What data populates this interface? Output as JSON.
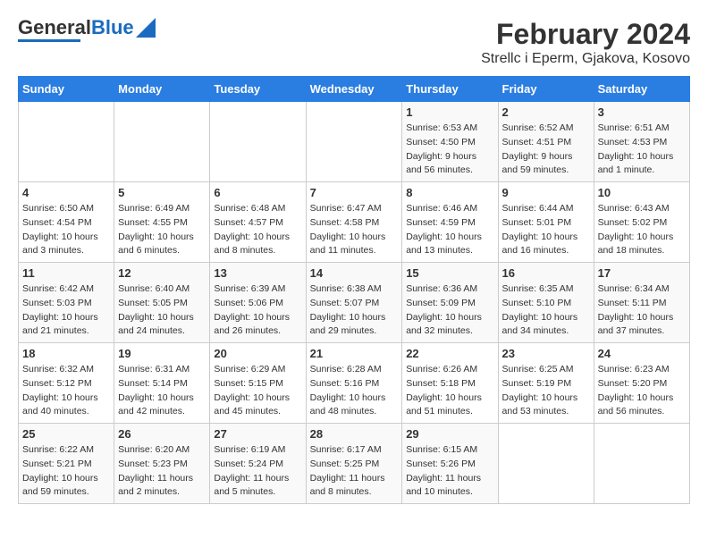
{
  "header": {
    "logo_general": "General",
    "logo_blue": "Blue",
    "title": "February 2024",
    "subtitle": "Strellc i Eperm, Gjakova, Kosovo"
  },
  "calendar": {
    "days_of_week": [
      "Sunday",
      "Monday",
      "Tuesday",
      "Wednesday",
      "Thursday",
      "Friday",
      "Saturday"
    ],
    "weeks": [
      [
        {
          "day": "",
          "info": ""
        },
        {
          "day": "",
          "info": ""
        },
        {
          "day": "",
          "info": ""
        },
        {
          "day": "",
          "info": ""
        },
        {
          "day": "1",
          "info": "Sunrise: 6:53 AM\nSunset: 4:50 PM\nDaylight: 9 hours and 56 minutes."
        },
        {
          "day": "2",
          "info": "Sunrise: 6:52 AM\nSunset: 4:51 PM\nDaylight: 9 hours and 59 minutes."
        },
        {
          "day": "3",
          "info": "Sunrise: 6:51 AM\nSunset: 4:53 PM\nDaylight: 10 hours and 1 minute."
        }
      ],
      [
        {
          "day": "4",
          "info": "Sunrise: 6:50 AM\nSunset: 4:54 PM\nDaylight: 10 hours and 3 minutes."
        },
        {
          "day": "5",
          "info": "Sunrise: 6:49 AM\nSunset: 4:55 PM\nDaylight: 10 hours and 6 minutes."
        },
        {
          "day": "6",
          "info": "Sunrise: 6:48 AM\nSunset: 4:57 PM\nDaylight: 10 hours and 8 minutes."
        },
        {
          "day": "7",
          "info": "Sunrise: 6:47 AM\nSunset: 4:58 PM\nDaylight: 10 hours and 11 minutes."
        },
        {
          "day": "8",
          "info": "Sunrise: 6:46 AM\nSunset: 4:59 PM\nDaylight: 10 hours and 13 minutes."
        },
        {
          "day": "9",
          "info": "Sunrise: 6:44 AM\nSunset: 5:01 PM\nDaylight: 10 hours and 16 minutes."
        },
        {
          "day": "10",
          "info": "Sunrise: 6:43 AM\nSunset: 5:02 PM\nDaylight: 10 hours and 18 minutes."
        }
      ],
      [
        {
          "day": "11",
          "info": "Sunrise: 6:42 AM\nSunset: 5:03 PM\nDaylight: 10 hours and 21 minutes."
        },
        {
          "day": "12",
          "info": "Sunrise: 6:40 AM\nSunset: 5:05 PM\nDaylight: 10 hours and 24 minutes."
        },
        {
          "day": "13",
          "info": "Sunrise: 6:39 AM\nSunset: 5:06 PM\nDaylight: 10 hours and 26 minutes."
        },
        {
          "day": "14",
          "info": "Sunrise: 6:38 AM\nSunset: 5:07 PM\nDaylight: 10 hours and 29 minutes."
        },
        {
          "day": "15",
          "info": "Sunrise: 6:36 AM\nSunset: 5:09 PM\nDaylight: 10 hours and 32 minutes."
        },
        {
          "day": "16",
          "info": "Sunrise: 6:35 AM\nSunset: 5:10 PM\nDaylight: 10 hours and 34 minutes."
        },
        {
          "day": "17",
          "info": "Sunrise: 6:34 AM\nSunset: 5:11 PM\nDaylight: 10 hours and 37 minutes."
        }
      ],
      [
        {
          "day": "18",
          "info": "Sunrise: 6:32 AM\nSunset: 5:12 PM\nDaylight: 10 hours and 40 minutes."
        },
        {
          "day": "19",
          "info": "Sunrise: 6:31 AM\nSunset: 5:14 PM\nDaylight: 10 hours and 42 minutes."
        },
        {
          "day": "20",
          "info": "Sunrise: 6:29 AM\nSunset: 5:15 PM\nDaylight: 10 hours and 45 minutes."
        },
        {
          "day": "21",
          "info": "Sunrise: 6:28 AM\nSunset: 5:16 PM\nDaylight: 10 hours and 48 minutes."
        },
        {
          "day": "22",
          "info": "Sunrise: 6:26 AM\nSunset: 5:18 PM\nDaylight: 10 hours and 51 minutes."
        },
        {
          "day": "23",
          "info": "Sunrise: 6:25 AM\nSunset: 5:19 PM\nDaylight: 10 hours and 53 minutes."
        },
        {
          "day": "24",
          "info": "Sunrise: 6:23 AM\nSunset: 5:20 PM\nDaylight: 10 hours and 56 minutes."
        }
      ],
      [
        {
          "day": "25",
          "info": "Sunrise: 6:22 AM\nSunset: 5:21 PM\nDaylight: 10 hours and 59 minutes."
        },
        {
          "day": "26",
          "info": "Sunrise: 6:20 AM\nSunset: 5:23 PM\nDaylight: 11 hours and 2 minutes."
        },
        {
          "day": "27",
          "info": "Sunrise: 6:19 AM\nSunset: 5:24 PM\nDaylight: 11 hours and 5 minutes."
        },
        {
          "day": "28",
          "info": "Sunrise: 6:17 AM\nSunset: 5:25 PM\nDaylight: 11 hours and 8 minutes."
        },
        {
          "day": "29",
          "info": "Sunrise: 6:15 AM\nSunset: 5:26 PM\nDaylight: 11 hours and 10 minutes."
        },
        {
          "day": "",
          "info": ""
        },
        {
          "day": "",
          "info": ""
        }
      ]
    ]
  }
}
